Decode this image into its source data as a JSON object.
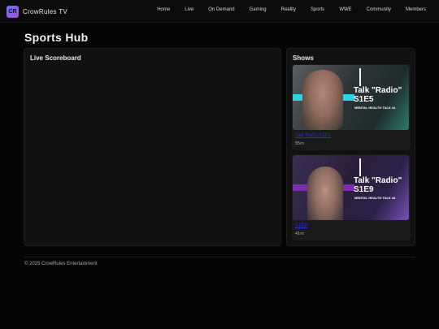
{
  "brand": {
    "logo_text": "CR",
    "name": "CrowRules TV"
  },
  "nav": [
    "Home",
    "Live",
    "On Demand",
    "Gaming",
    "Reality",
    "Sports",
    "WWE",
    "Community",
    "Members"
  ],
  "page_title": "Sports Hub",
  "scoreboard": {
    "title": "Live Scoreboard"
  },
  "shows": {
    "title": "Shows",
    "items": [
      {
        "thumb_title_1": "Talk \"Radio\"",
        "thumb_title_2": "S1E5",
        "thumb_sub": "MENTAL HEALTH TALK #4",
        "link": "Talk Radio S1E5",
        "duration": "55m"
      },
      {
        "thumb_title_1": "Talk \"Radio\"",
        "thumb_title_2": "S1E9",
        "thumb_sub": "MENTAL HEALTH TALK #8",
        "link": "S1E9",
        "duration": "41m"
      }
    ]
  },
  "footer": "© 2025 CrowRules Entertainment",
  "colors": {
    "accent_cyan": "#2fd3e2",
    "accent_purple": "#7b2fb0",
    "link": "#2233d9"
  }
}
